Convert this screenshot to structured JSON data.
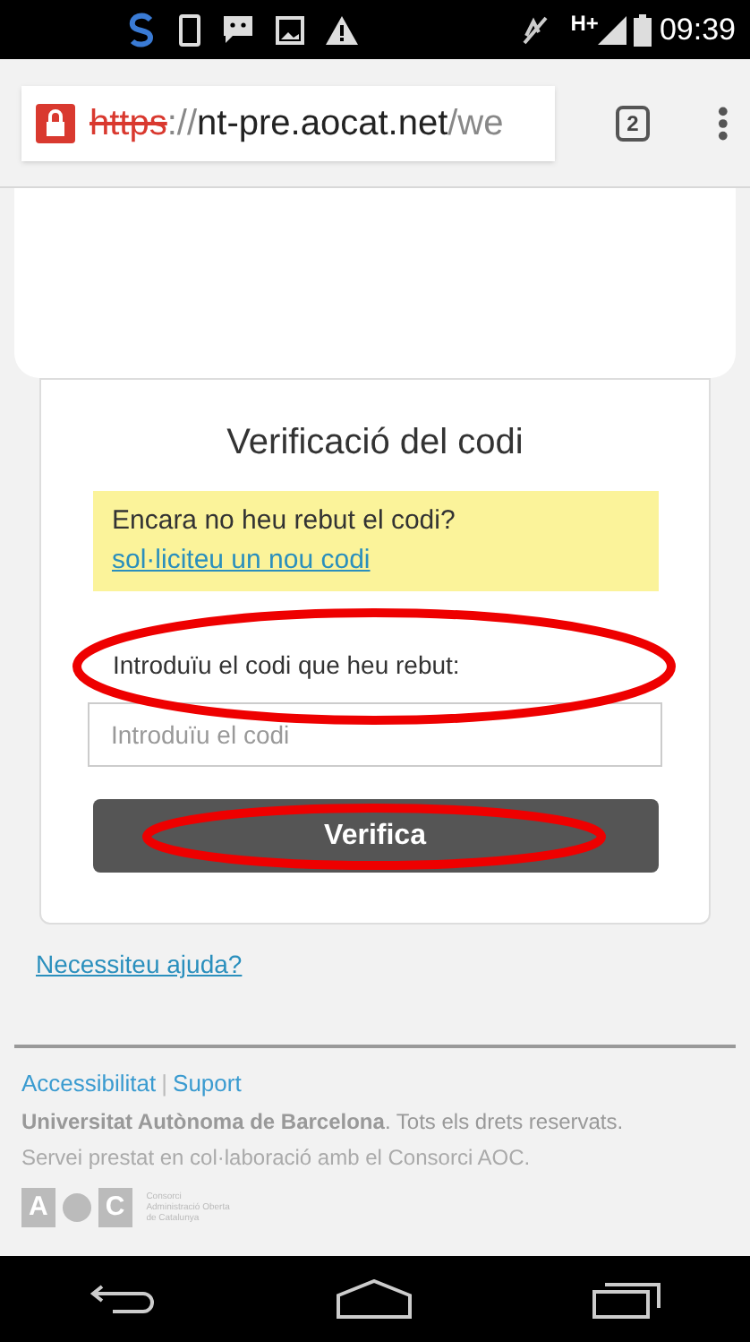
{
  "status_bar": {
    "network": "H+",
    "time": "09:39"
  },
  "browser": {
    "url": {
      "scheme": "https",
      "separator": "://",
      "host": "nt-pre.aocat.net",
      "path": "/we"
    },
    "tab_count": "2"
  },
  "card": {
    "title": "Verificació del codi",
    "notice": {
      "text": "Encara no heu rebut el codi?",
      "link": "sol·liciteu un nou codi"
    },
    "code_label": "Introduïu el codi que heu rebut:",
    "code_placeholder": "Introduïu el codi",
    "submit": "Verifica"
  },
  "help_link": "Necessiteu ajuda?",
  "footer": {
    "links": [
      "Accessibilitat",
      "Suport"
    ],
    "separator": "|",
    "copyright": "**Universitat Autònoma de Barcelona**. Tots els drets reservats.",
    "service": "Servei prestat en col·laboració amb el Consorci AOC.",
    "logo": {
      "left_letter": "A",
      "right_letter": "C",
      "caption": [
        "Consorci",
        "Administració Oberta",
        "de Catalunya"
      ]
    }
  }
}
